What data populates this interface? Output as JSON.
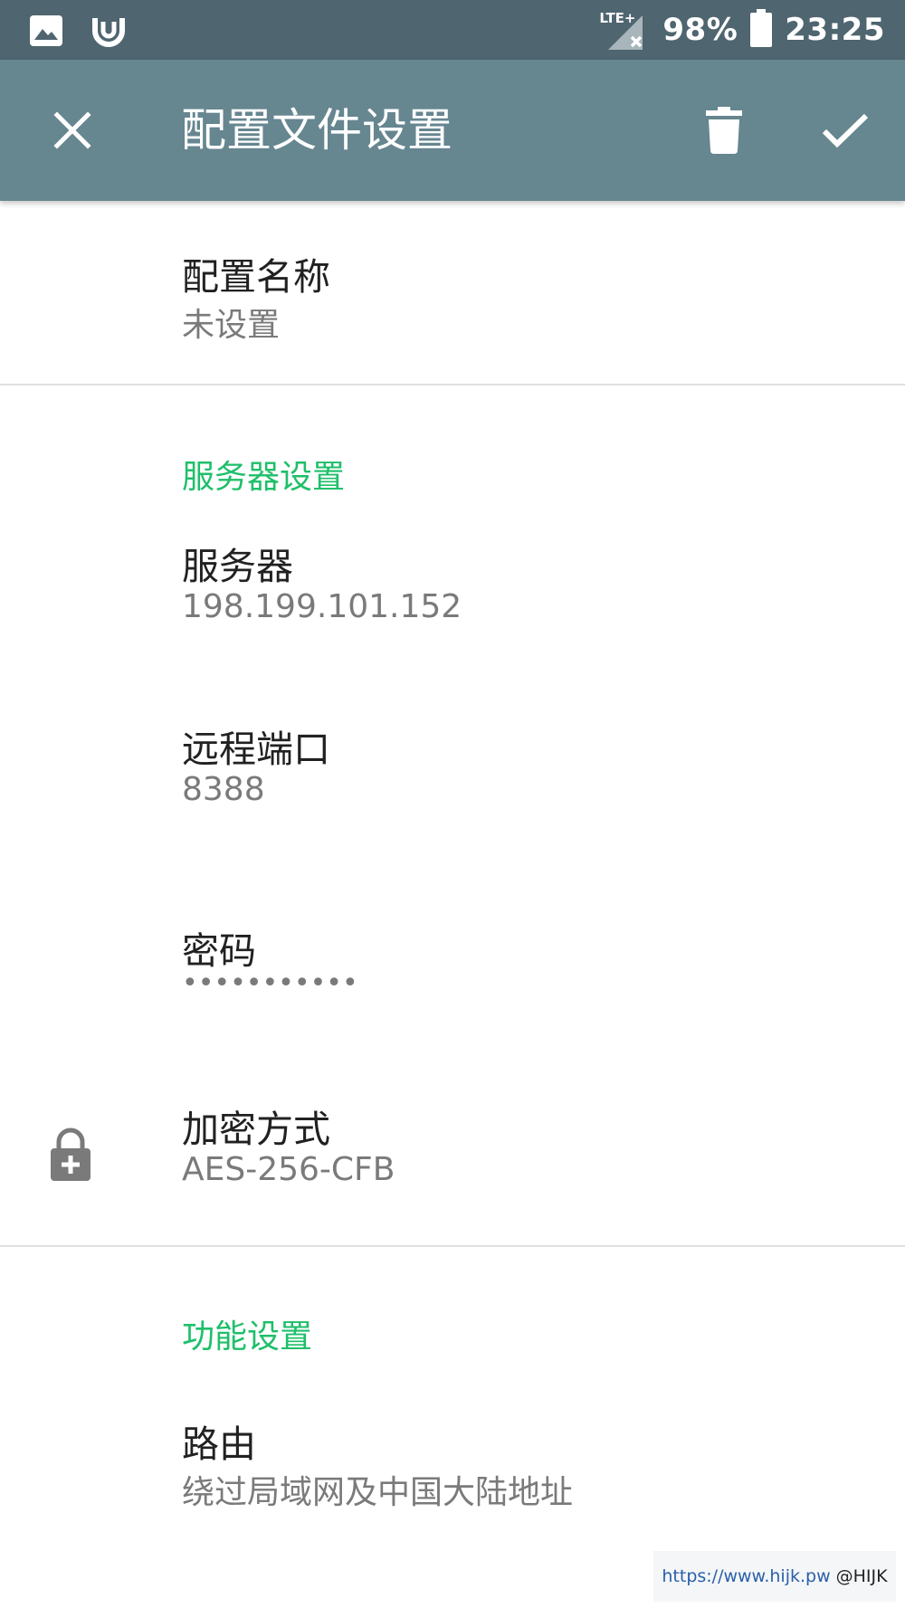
{
  "status_bar": {
    "network": "LTE+",
    "battery": "98%",
    "time": "23:25",
    "icons": [
      "image-notification-icon",
      "app-notification-icon",
      "signal-icon",
      "battery-icon"
    ]
  },
  "app_bar": {
    "title": "配置文件设置",
    "icons": [
      "close-icon",
      "delete-icon",
      "check-icon"
    ]
  },
  "profile": {
    "name_title": "配置名称",
    "name_summary": "未设置"
  },
  "server_section": {
    "header": "服务器设置",
    "server_title": "服务器",
    "server_value": "198.199.101.152",
    "port_title": "远程端口",
    "port_value": "8388",
    "password_title": "密码",
    "password_value": "•••••••••••",
    "encryption_title": "加密方式",
    "encryption_value": "AES-256-CFB"
  },
  "feature_section": {
    "header": "功能设置",
    "route_title": "路由",
    "route_value": "绕过局域网及中国大陆地址"
  },
  "watermark": {
    "url": "https://www.hijk.pw",
    "handle": "@HIJK"
  },
  "colors": {
    "status_bar": "#4f6570",
    "app_bar": "#668690",
    "accent": "#1fbf6a",
    "watermark_link": "#2a5fa8"
  }
}
